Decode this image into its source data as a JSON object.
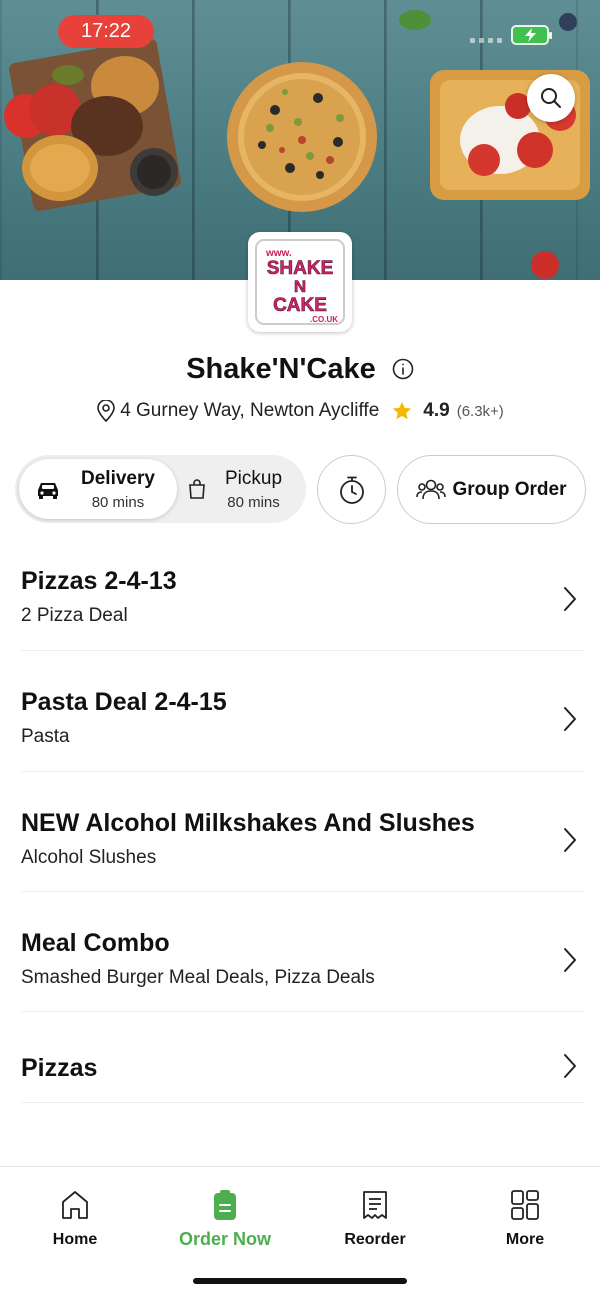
{
  "status_bar": {
    "time": "17:22"
  },
  "store": {
    "name": "Shake'N'Cake",
    "address": "4 Gurney Way, Newton Aycliffe",
    "rating": "4.9",
    "rating_count": "(6.3k+)",
    "logo_text": [
      "www.",
      "SHAKE",
      "N",
      "CAKE",
      ".CO.UK"
    ]
  },
  "modes": {
    "delivery": {
      "label": "Delivery",
      "time": "80 mins"
    },
    "pickup": {
      "label": "Pickup",
      "time": "80 mins"
    }
  },
  "group_order": {
    "label": "Group Order"
  },
  "categories": [
    {
      "title": "Pizzas 2-4-13",
      "subtitle": "2 Pizza Deal"
    },
    {
      "title": "Pasta Deal 2-4-15",
      "subtitle": "Pasta"
    },
    {
      "title": "NEW Alcohol Milkshakes And Slushes",
      "subtitle": "Alcohol Slushes"
    },
    {
      "title": "Meal Combo",
      "subtitle": "Smashed Burger Meal Deals, Pizza Deals"
    },
    {
      "title": "Pizzas",
      "subtitle": ""
    }
  ],
  "nav": [
    {
      "label": "Home",
      "icon": "home-icon"
    },
    {
      "label": "Order Now",
      "icon": "order-icon"
    },
    {
      "label": "Reorder",
      "icon": "receipt-icon"
    },
    {
      "label": "More",
      "icon": "grid-icon"
    }
  ],
  "colors": {
    "accent_green": "#4cae4f",
    "time_pill": "#e8413a",
    "star": "#f5b800",
    "logo_pink": "#d0246b"
  }
}
